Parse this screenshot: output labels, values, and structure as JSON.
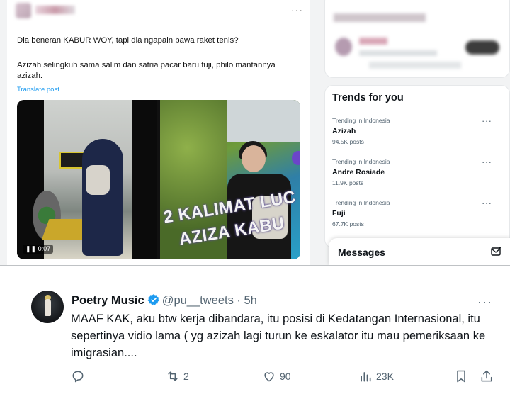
{
  "top_post": {
    "text_line1": "Dia beneran KABUR WOY, tapi dia ngapain bawa raket tenis?",
    "text_line2": "Azizah selingkuh sama salim dan satria pacar baru fuji,  philo mantannya",
    "text_line3": "azizah.",
    "translate_label": "Translate post",
    "video_time": "0:07",
    "overlay_line1": "2 KALIMAT LUC",
    "overlay_line2": "AZIZA KABU"
  },
  "trends": {
    "title": "Trends for you",
    "items": [
      {
        "meta": "Trending in Indonesia",
        "name": "Azizah",
        "posts": "94.5K posts"
      },
      {
        "meta": "Trending in Indonesia",
        "name": "Andre Rosiade",
        "posts": "11.9K posts"
      },
      {
        "meta": "Trending in Indonesia",
        "name": "Fuji",
        "posts": "67.7K posts"
      }
    ]
  },
  "messages": {
    "label": "Messages"
  },
  "reply": {
    "display_name": "Poetry Music",
    "handle": "@pu__tweets · 5h",
    "text": "MAAF KAK, aku btw kerja dibandara, itu posisi di Kedatangan Internasional, itu sepertinya vidio lama ( yg azizah lagi turun ke eskalator itu mau pemeriksaan ke imigrasian....",
    "retweets": "2",
    "likes": "90",
    "views": "23K"
  },
  "colors": {
    "accent": "#1d9bf0",
    "muted": "#536471",
    "verified": "#1d9bf0"
  }
}
